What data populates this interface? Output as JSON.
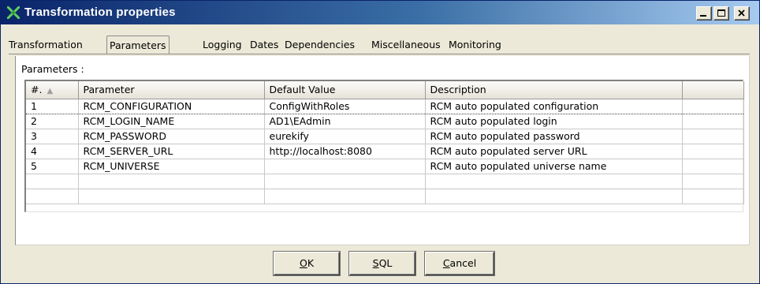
{
  "window": {
    "title": "Transformation properties"
  },
  "tabs": [
    {
      "label": "Transformation",
      "active": false
    },
    {
      "label": "Parameters",
      "active": true
    },
    {
      "label": "Logging",
      "active": false
    },
    {
      "label": "Dates",
      "active": false
    },
    {
      "label": "Dependencies",
      "active": false
    },
    {
      "label": "Miscellaneous",
      "active": false
    },
    {
      "label": "Monitoring",
      "active": false
    }
  ],
  "parameters": {
    "label": "Parameters :",
    "columns": [
      "#.",
      "Parameter",
      "Default Value",
      "Description"
    ],
    "rows": [
      [
        "1",
        "RCM_CONFIGURATION",
        "ConfigWithRoles",
        "RCM auto populated configuration"
      ],
      [
        "2",
        "RCM_LOGIN_NAME",
        "AD1\\EAdmin",
        "RCM auto populated login"
      ],
      [
        "3",
        "RCM_PASSWORD",
        "eurekify",
        "RCM auto populated password"
      ],
      [
        "4",
        "RCM_SERVER_URL",
        "http://localhost:8080",
        "RCM auto populated server URL"
      ],
      [
        "5",
        "RCM_UNIVERSE",
        "",
        "RCM auto populated universe name"
      ]
    ]
  },
  "buttons": {
    "ok_mnemonic": "O",
    "ok_rest": "K",
    "sql_mnemonic": "S",
    "sql_rest": "QL",
    "cancel_mnemonic": "C",
    "cancel_rest": "ancel"
  },
  "colors": {
    "titlebar_start": "#0a246a",
    "titlebar_end": "#a6caf0",
    "dialog_bg": "#ece9d8"
  }
}
